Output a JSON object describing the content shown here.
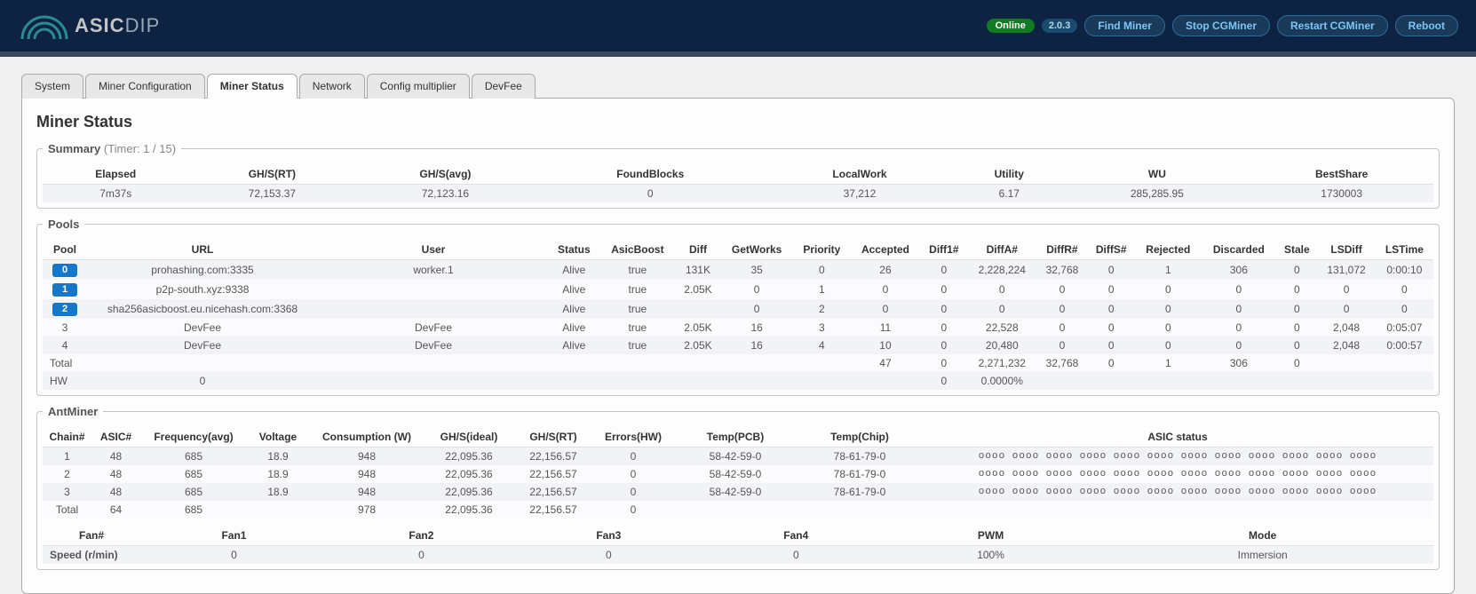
{
  "header": {
    "brand_a": "ASIC",
    "brand_b": "DIP",
    "status": "Online",
    "version": "2.0.3",
    "buttons": {
      "find": "Find Miner",
      "stop": "Stop CGMiner",
      "restart": "Restart CGMiner",
      "reboot": "Reboot"
    }
  },
  "tabs": {
    "system": "System",
    "config": "Miner Configuration",
    "status": "Miner Status",
    "network": "Network",
    "multiplier": "Config multiplier",
    "devfee": "DevFee"
  },
  "page_title": "Miner Status",
  "summary": {
    "legend_a": "Summary",
    "legend_b": "(Timer: 1 / 15)",
    "headers": {
      "elapsed": "Elapsed",
      "ghs_rt": "GH/S(RT)",
      "ghs_avg": "GH/S(avg)",
      "found": "FoundBlocks",
      "local": "LocalWork",
      "utility": "Utility",
      "wu": "WU",
      "best": "BestShare"
    },
    "row": {
      "elapsed": "7m37s",
      "ghs_rt": "72,153.37",
      "ghs_avg": "72,123.16",
      "found": "0",
      "local": "37,212",
      "utility": "6.17",
      "wu": "285,285.95",
      "best": "1730003"
    }
  },
  "pools": {
    "legend": "Pools",
    "headers": {
      "pool": "Pool",
      "url": "URL",
      "user": "User",
      "status": "Status",
      "asicboost": "AsicBoost",
      "diff": "Diff",
      "getworks": "GetWorks",
      "priority": "Priority",
      "accepted": "Accepted",
      "diff1": "Diff1#",
      "diffa": "DiffA#",
      "diffr": "DiffR#",
      "diffs": "DiffS#",
      "rejected": "Rejected",
      "discarded": "Discarded",
      "stale": "Stale",
      "lsdiff": "LSDiff",
      "lstime": "LSTime"
    },
    "rows": [
      {
        "idx": "0",
        "badge": true,
        "url": "prohashing.com:3335",
        "user": "worker.1",
        "status": "Alive",
        "asicboost": "true",
        "diff": "131K",
        "getworks": "35",
        "priority": "0",
        "accepted": "26",
        "diff1": "0",
        "diffa": "2,228,224",
        "diffr": "32,768",
        "diffs": "0",
        "rejected": "1",
        "discarded": "306",
        "stale": "0",
        "lsdiff": "131,072",
        "lstime": "0:00:10"
      },
      {
        "idx": "1",
        "badge": true,
        "url": "p2p-south.xyz:9338",
        "user": "",
        "status": "Alive",
        "asicboost": "true",
        "diff": "2.05K",
        "getworks": "0",
        "priority": "1",
        "accepted": "0",
        "diff1": "0",
        "diffa": "0",
        "diffr": "0",
        "diffs": "0",
        "rejected": "0",
        "discarded": "0",
        "stale": "0",
        "lsdiff": "0",
        "lstime": "0"
      },
      {
        "idx": "2",
        "badge": true,
        "url": "sha256asicboost.eu.nicehash.com:3368",
        "user": "",
        "status": "Alive",
        "asicboost": "true",
        "diff": "",
        "getworks": "0",
        "priority": "2",
        "accepted": "0",
        "diff1": "0",
        "diffa": "0",
        "diffr": "0",
        "diffs": "0",
        "rejected": "0",
        "discarded": "0",
        "stale": "0",
        "lsdiff": "0",
        "lstime": "0"
      },
      {
        "idx": "3",
        "badge": false,
        "url": "DevFee",
        "user": "DevFee",
        "status": "Alive",
        "asicboost": "true",
        "diff": "2.05K",
        "getworks": "16",
        "priority": "3",
        "accepted": "11",
        "diff1": "0",
        "diffa": "22,528",
        "diffr": "0",
        "diffs": "0",
        "rejected": "0",
        "discarded": "0",
        "stale": "0",
        "lsdiff": "2,048",
        "lstime": "0:05:07"
      },
      {
        "idx": "4",
        "badge": false,
        "url": "DevFee",
        "user": "DevFee",
        "status": "Alive",
        "asicboost": "true",
        "diff": "2.05K",
        "getworks": "16",
        "priority": "4",
        "accepted": "10",
        "diff1": "0",
        "diffa": "20,480",
        "diffr": "0",
        "diffs": "0",
        "rejected": "0",
        "discarded": "0",
        "stale": "0",
        "lsdiff": "2,048",
        "lstime": "0:00:57"
      }
    ],
    "total_label": "Total",
    "total": {
      "accepted": "47",
      "diff1": "0",
      "diffa": "2,271,232",
      "diffr": "32,768",
      "diffs": "0",
      "rejected": "1",
      "discarded": "306",
      "stale": "0"
    },
    "hw_label": "HW",
    "hw": {
      "url": "0",
      "diff1": "0",
      "diffa": "0.0000%"
    }
  },
  "antminer": {
    "legend": "AntMiner",
    "chain_headers": {
      "chain": "Chain#",
      "asic": "ASIC#",
      "freq": "Frequency(avg)",
      "volt": "Voltage",
      "cons": "Consumption (W)",
      "ideal": "GH/S(ideal)",
      "rt": "GH/S(RT)",
      "err": "Errors(HW)",
      "pcb": "Temp(PCB)",
      "chip": "Temp(Chip)",
      "status": "ASIC status"
    },
    "chains": [
      {
        "chain": "1",
        "asic": "48",
        "freq": "685",
        "volt": "18.9",
        "cons": "948",
        "ideal": "22,095.36",
        "rt": "22,156.57",
        "err": "0",
        "pcb": "58-42-59-0",
        "chip": "78-61-79-0",
        "status": "oooo oooo oooo oooo oooo oooo oooo oooo oooo oooo oooo oooo"
      },
      {
        "chain": "2",
        "asic": "48",
        "freq": "685",
        "volt": "18.9",
        "cons": "948",
        "ideal": "22,095.36",
        "rt": "22,156.57",
        "err": "0",
        "pcb": "58-42-59-0",
        "chip": "78-61-79-0",
        "status": "oooo oooo oooo oooo oooo oooo oooo oooo oooo oooo oooo oooo"
      },
      {
        "chain": "3",
        "asic": "48",
        "freq": "685",
        "volt": "18.9",
        "cons": "948",
        "ideal": "22,095.36",
        "rt": "22,156.57",
        "err": "0",
        "pcb": "58-42-59-0",
        "chip": "78-61-79-0",
        "status": "oooo oooo oooo oooo oooo oooo oooo oooo oooo oooo oooo oooo"
      }
    ],
    "chain_total_label": "Total",
    "chain_total": {
      "asic": "64",
      "freq": "685",
      "volt": "",
      "cons": "978",
      "ideal": "22,095.36",
      "rt": "22,156.57",
      "err": "0"
    },
    "fan_headers": {
      "num": "Fan#",
      "f1": "Fan1",
      "f2": "Fan2",
      "f3": "Fan3",
      "f4": "Fan4",
      "pwm": "PWM",
      "mode": "Mode"
    },
    "fan_row_label": "Speed (r/min)",
    "fan_row": {
      "f1": "0",
      "f2": "0",
      "f3": "0",
      "f4": "0",
      "pwm": "100%",
      "mode": "Immersion"
    }
  }
}
